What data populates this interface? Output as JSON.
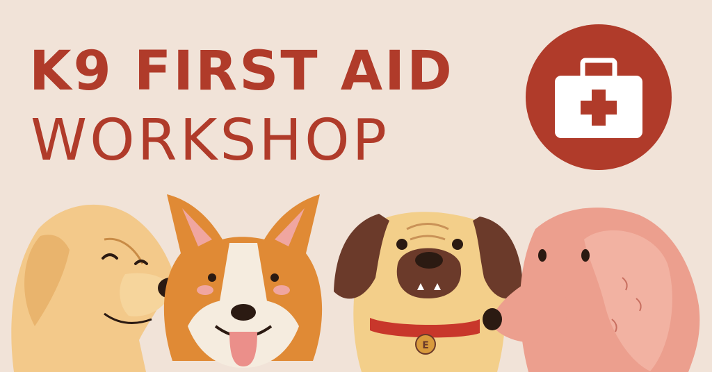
{
  "title": {
    "line1": "K9 FIRST AID",
    "line2": "WORKSHOP"
  },
  "icons": {
    "kit": "first-aid-kit-icon",
    "tag_letter": "E"
  },
  "colors": {
    "background": "#f1e3d8",
    "accent": "#b03b2a",
    "kit_white": "#ffffff"
  }
}
